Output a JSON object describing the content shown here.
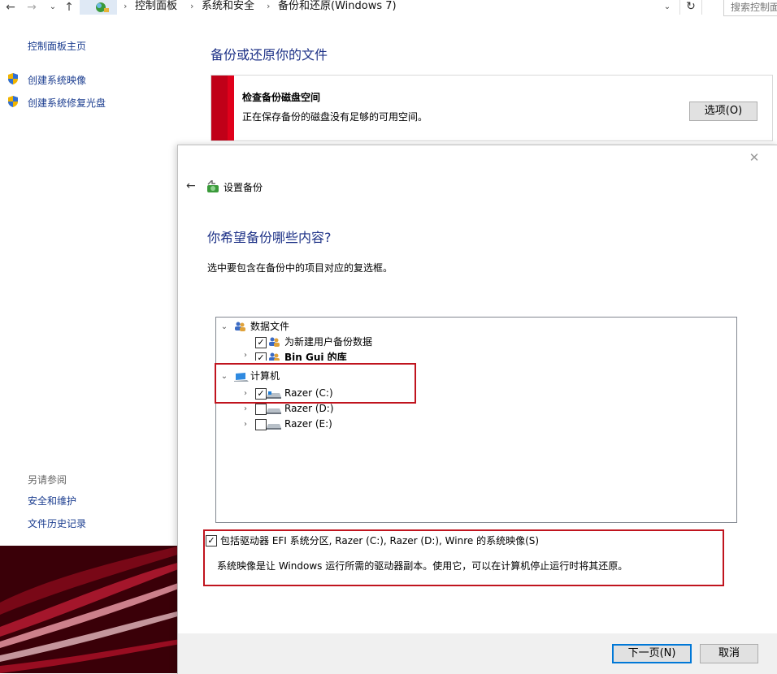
{
  "address_bar": {
    "breadcrumbs": [
      "控制面板",
      "系统和安全",
      "备份和还原(Windows 7)"
    ],
    "search_placeholder": "搜索控制面板"
  },
  "left_pane": {
    "home": "控制面板主页",
    "links": [
      "创建系统映像",
      "创建系统修复光盘"
    ],
    "see_also_title": "另请参阅",
    "see_also": [
      "安全和维护",
      "文件历史记录"
    ]
  },
  "main": {
    "title": "备份或还原你的文件",
    "warning": {
      "title": "检查备份磁盘空间",
      "description": "正在保存备份的磁盘没有足够的可用空间。",
      "options_button": "选项(O)"
    }
  },
  "dialog": {
    "title": "设置备份",
    "question": "你希望备份哪些内容?",
    "instruction": "选中要包含在备份中的项目对应的复选框。",
    "tree": {
      "data_files": {
        "label": "数据文件",
        "children": [
          {
            "label": "为新建用户备份数据",
            "checked": true
          },
          {
            "label": "Bin Gui 的库",
            "checked": true
          }
        ]
      },
      "computer": {
        "label": "计算机",
        "drives": [
          {
            "label": "Razer (C:)",
            "checked": true
          },
          {
            "label": "Razer (D:)",
            "checked": false
          },
          {
            "label": "Razer (E:)",
            "checked": false
          }
        ]
      }
    },
    "system_image": {
      "checked": true,
      "label": "包括驱动器 EFI 系统分区, Razer (C:), Razer (D:), Winre 的系统映像(S)",
      "description": "系统映像是让 Windows 运行所需的驱动器副本。使用它，可以在计算机停止运行时将其还原。"
    },
    "buttons": {
      "next": "下一页(N)",
      "cancel": "取消"
    }
  },
  "colors": {
    "link": "#1a3c8f",
    "heading": "#1e3287",
    "warning_red": "#c00018",
    "highlight": "#c0141e"
  }
}
